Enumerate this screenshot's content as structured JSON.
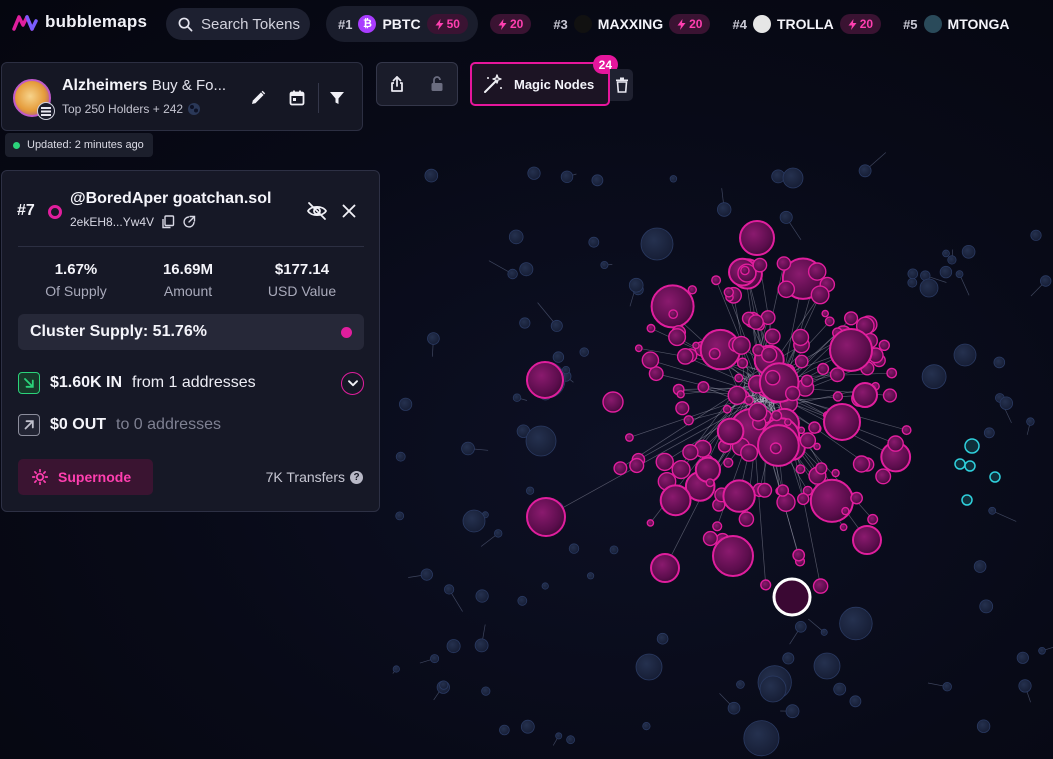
{
  "app": {
    "name": "bubblemaps"
  },
  "search": {
    "placeholder": "Search Tokens"
  },
  "ticker": [
    {
      "rank": "#1",
      "name": "PBTC",
      "boost": "50",
      "icon_color": "#a93cff",
      "icon": "bitcoin-icon"
    },
    {
      "rank": "",
      "name": "",
      "boost": "20",
      "icon_color": "",
      "icon": ""
    },
    {
      "rank": "#3",
      "name": "MAXXING",
      "boost": "20",
      "icon_color": "#111111",
      "icon": "token-avatar-icon"
    },
    {
      "rank": "#4",
      "name": "TROLLA",
      "boost": "20",
      "icon_color": "#e6e6e6",
      "icon": "token-avatar-icon"
    },
    {
      "rank": "#5",
      "name": "MTONGA",
      "boost": "",
      "icon_color": "#2a4a5a",
      "icon": "token-avatar-icon"
    }
  ],
  "token": {
    "name": "Alzheimers",
    "name_suffix": "Buy & Fo...",
    "subtitle": "Top 250 Holders + 242",
    "updated": "Updated: 2 minutes ago"
  },
  "toolbar": {
    "magic_label": "Magic Nodes",
    "magic_count": "24"
  },
  "wallet": {
    "rank": "#7",
    "name": "@BoredAper goatchan.sol",
    "address": "2ekEH8...Yw4V",
    "stats": [
      {
        "value": "1.67%",
        "label": "Of Supply"
      },
      {
        "value": "16.69M",
        "label": "Amount"
      },
      {
        "value": "$177.14",
        "label": "USD Value"
      }
    ],
    "cluster_label": "Cluster Supply: 51.76%",
    "in_amount": "$1.60K IN",
    "in_from": "from 1 addresses",
    "out_amount": "$0 OUT",
    "out_to": "to 0 addresses",
    "supernode_label": "Supernode",
    "transfers": "7K Transfers"
  },
  "colors": {
    "accent": "#e01e9d",
    "node_dim": "#1e2a48",
    "cyan": "#2fd0dc",
    "green": "#2bd37a"
  }
}
